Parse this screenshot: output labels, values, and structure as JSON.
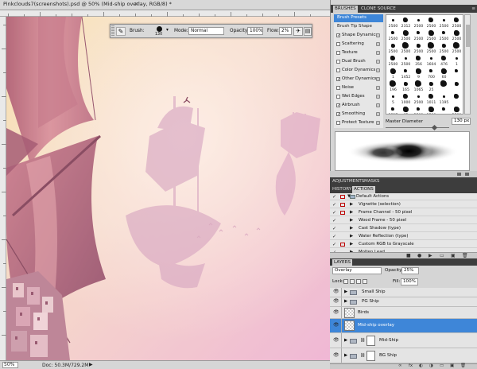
{
  "document": {
    "title": "Pinkclouds7(screenshots).psd @ 50% (Mid-ship overlay, RGB/8) *",
    "close_glyph": "×",
    "zoom": "50%",
    "doc_size": "Doc: 50.3M/729.2M",
    "status_arrow": "▶"
  },
  "options_bar": {
    "brush_label": "Brush:",
    "brush_size": "130",
    "mode_label": "Mode:",
    "mode_value": "Normal",
    "opacity_label": "Opacity:",
    "opacity_value": "100%",
    "flow_label": "Flow:",
    "flow_value": "2%",
    "tool_icon": "brush-icon",
    "dropdown_glyph": "▾"
  },
  "brushes_panel": {
    "tabs": [
      "BRUSHES",
      "CLONE SOURCE"
    ],
    "menu_glyph": "≡",
    "brush_presets": "Brush Presets",
    "brush_tip_shape": "Brush Tip Shape",
    "options": [
      {
        "label": "Shape Dynamics",
        "checked": true
      },
      {
        "label": "Scattering",
        "checked": false
      },
      {
        "label": "Texture",
        "checked": false
      },
      {
        "label": "Dual Brush",
        "checked": false
      },
      {
        "label": "Color Dynamics",
        "checked": false
      },
      {
        "label": "Other Dynamics",
        "checked": true
      },
      {
        "label": "Noise",
        "checked": false
      },
      {
        "label": "Wet Edges",
        "checked": false
      },
      {
        "label": "Airbrush",
        "checked": true
      },
      {
        "label": "Smoothing",
        "checked": true
      },
      {
        "label": "Protect Texture",
        "checked": false
      }
    ],
    "grid_sizes": [
      [
        "2500",
        "2312",
        "2500",
        "2500",
        "2500",
        "2500"
      ],
      [
        "2500",
        "2500",
        "2500",
        "2500",
        "2500",
        "2500"
      ],
      [
        "2500",
        "2500",
        "2500",
        "2500",
        "2500",
        "2500"
      ],
      [
        "2500",
        "2500",
        "356",
        "1604",
        "476",
        "1"
      ],
      [
        "1",
        "1452",
        "9",
        "700",
        "60",
        ""
      ],
      [
        "196",
        "165",
        "1065",
        "25",
        "",
        ""
      ],
      [
        "5",
        "1000",
        "2500",
        "1011",
        "1195",
        ""
      ],
      [
        "2317",
        "65",
        "2500",
        "2500",
        "",
        "2500"
      ]
    ],
    "master_diameter_label": "Master Diameter",
    "master_diameter_value": "130 px"
  },
  "adjustments_tabs": [
    "ADJUSTMENTS",
    "MASKS"
  ],
  "actions_panel": {
    "tabs": [
      "HISTORY",
      "ACTIONS"
    ],
    "rows": [
      {
        "name": "Default Actions",
        "group": true,
        "expanded": true,
        "dialog": true
      },
      {
        "name": "Vignette (selection)",
        "group": false,
        "dialog": true
      },
      {
        "name": "Frame Channel - 50 pixel",
        "group": false,
        "dialog": true
      },
      {
        "name": "Wood Frame - 50 pixel",
        "group": false,
        "dialog": false
      },
      {
        "name": "Cast Shadow (type)",
        "group": false,
        "dialog": false
      },
      {
        "name": "Water Reflection (type)",
        "group": false,
        "dialog": false
      },
      {
        "name": "Custom RGB to Grayscale",
        "group": false,
        "dialog": true
      },
      {
        "name": "Molten Lead",
        "group": false,
        "dialog": false
      }
    ],
    "bottom_icons": [
      "■",
      "●",
      "▶",
      "▭",
      "▣",
      "🗑"
    ]
  },
  "layers_panel": {
    "tab": "LAYERS",
    "blend_mode": "Overlay",
    "opacity_label": "Opacity:",
    "opacity_value": "25%",
    "lock_label": "Lock:",
    "fill_label": "Fill:",
    "fill_value": "100%",
    "layers": [
      {
        "name": "Small Ship",
        "type": "group",
        "selected": false
      },
      {
        "name": "PG Ship",
        "type": "group",
        "selected": false
      },
      {
        "name": "Birds",
        "type": "layer",
        "selected": false
      },
      {
        "name": "Mid-ship overlay",
        "type": "layer",
        "selected": true
      },
      {
        "name": "Mid-Ship",
        "type": "masked-group",
        "selected": false
      },
      {
        "name": "BG Ship",
        "type": "masked-group",
        "selected": false
      }
    ],
    "bottom_icons": [
      "∞",
      "fx",
      "◐",
      "◑",
      "▭",
      "▣",
      "🗑"
    ]
  },
  "colors": {
    "selection": "#3e86d8",
    "panel_bg": "#d5d5d5",
    "tab_bar": "#3d3d3d"
  },
  "glyphs": {
    "eye": "👁",
    "check": "✓",
    "tri_right": "▶",
    "tri_down": "▼",
    "chain": "⛓"
  }
}
